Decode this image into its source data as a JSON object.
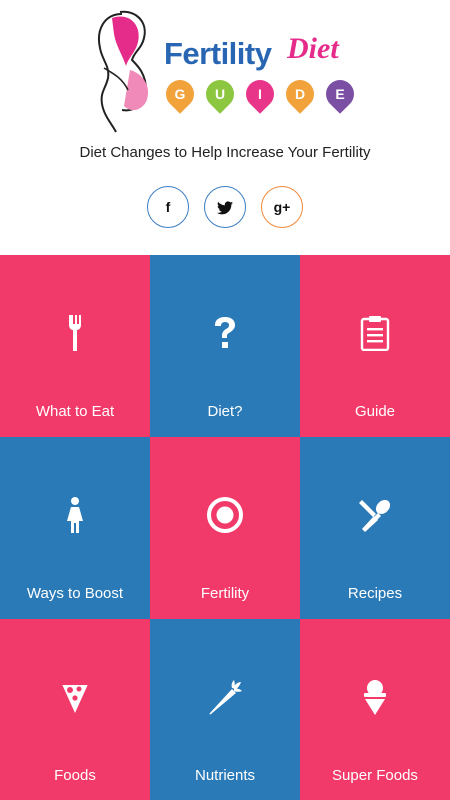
{
  "brand": {
    "word": "Fertility",
    "diet": "Diet",
    "guide_letters": [
      "G",
      "U",
      "I",
      "D",
      "E"
    ],
    "pin_colors": [
      "#f2a23a",
      "#8dc63f",
      "#e8358a",
      "#f2a23a",
      "#7b4fa3"
    ],
    "tagline": "Diet Changes to Help Increase Your Fertility"
  },
  "social": {
    "facebook": "f",
    "twitter_icon": "twitter-icon",
    "gplus": "g+"
  },
  "colors": {
    "pink": "#f23a6a",
    "blue": "#2b7ab8",
    "brand_blue": "#2866b3",
    "brand_pink": "#e52c8a"
  },
  "tiles": [
    {
      "label": "What to Eat",
      "icon": "fork-icon",
      "color": "pink"
    },
    {
      "label": "Diet?",
      "icon": "question-icon",
      "color": "blue"
    },
    {
      "label": "Guide",
      "icon": "clipboard-icon",
      "color": "pink"
    },
    {
      "label": "Ways to Boost",
      "icon": "woman-icon",
      "color": "blue"
    },
    {
      "label": "Fertility",
      "icon": "target-icon",
      "color": "pink"
    },
    {
      "label": "Recipes",
      "icon": "spoon-knife-icon",
      "color": "blue"
    },
    {
      "label": "Foods",
      "icon": "pizza-icon",
      "color": "pink"
    },
    {
      "label": "Nutrients",
      "icon": "carrot-icon",
      "color": "blue"
    },
    {
      "label": "Super Foods",
      "icon": "ice-cream-icon",
      "color": "pink"
    }
  ]
}
